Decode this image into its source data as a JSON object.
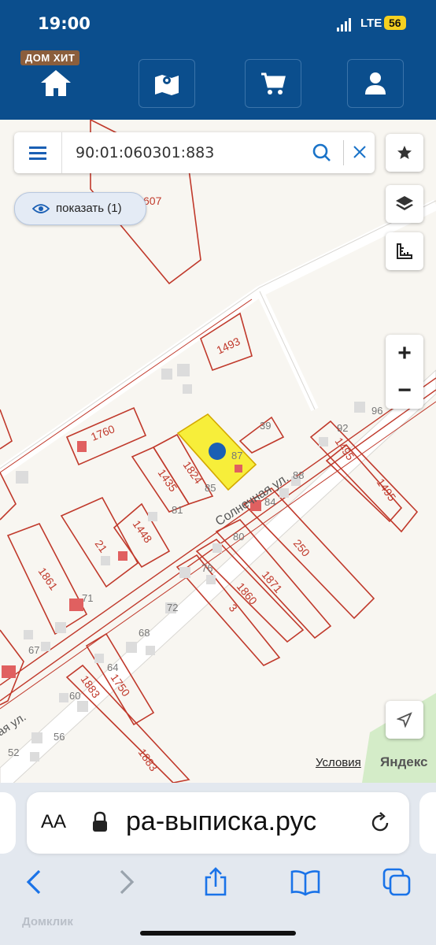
{
  "status": {
    "time": "19:00",
    "network": "LTE",
    "battery": "56"
  },
  "app": {
    "logo": "ДОМ ХИТ",
    "nav": [
      "home-icon",
      "map-icon",
      "cart-icon",
      "user-icon"
    ]
  },
  "search": {
    "query": "90:01:060301:883"
  },
  "show_button": {
    "label": "показать (1)"
  },
  "zoom": {
    "in": "+",
    "out": "−"
  },
  "map": {
    "parcel_labels": [
      "607",
      "1493",
      "1760",
      "1824",
      "1435",
      "87",
      "39",
      "85",
      "81",
      "1448",
      "21",
      "1861",
      "71",
      "67",
      "1495",
      "1495",
      "92",
      "96",
      "88",
      "84",
      "250",
      "80",
      "1871",
      "76",
      "1860",
      "3",
      "72",
      "68",
      "64",
      "1750",
      "1883",
      "60",
      "1883",
      "56",
      "52"
    ],
    "street": "Солнечная ул.",
    "street2": "ая ул.",
    "terms": "Условия",
    "provider": "Яндекс"
  },
  "browser": {
    "aa": "AA",
    "url": "ра-выписка.рус",
    "watermark": "Домклик"
  }
}
